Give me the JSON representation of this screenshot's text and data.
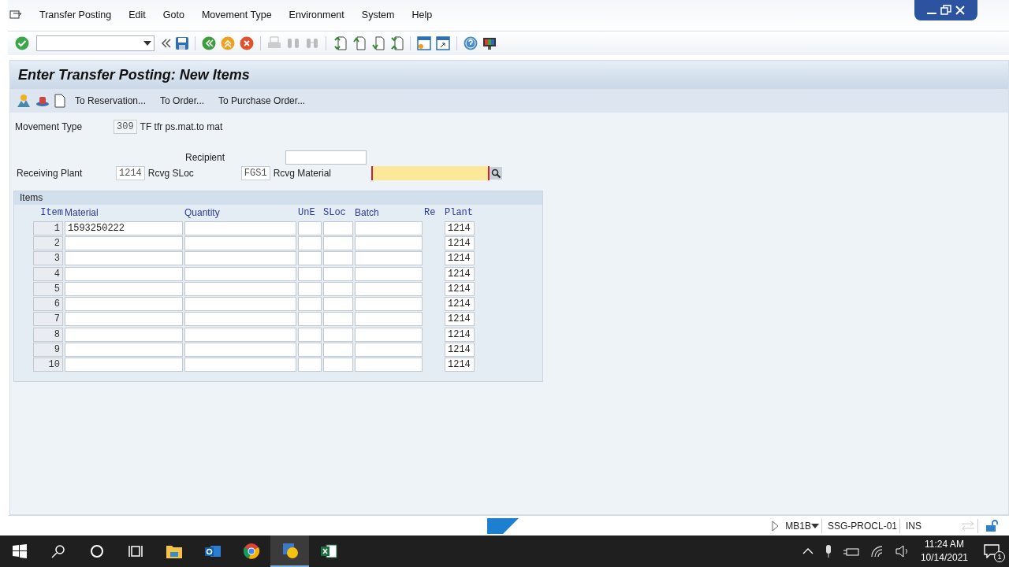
{
  "menu": [
    "Transfer Posting",
    "Edit",
    "Goto",
    "Movement Type",
    "Environment",
    "System",
    "Help"
  ],
  "title": "Enter Transfer Posting: New Items",
  "app_toolbar": [
    "To Reservation...",
    "To Order...",
    "To Purchase Order..."
  ],
  "header": {
    "movement_type": {
      "label": "Movement Type",
      "value": "309",
      "description": "TF tfr ps.mat.to mat"
    },
    "recipient": {
      "label": "Recipient"
    },
    "receiving_plant": {
      "label": "Receiving Plant",
      "value": "1214"
    },
    "rcvg_sloc": {
      "label": "Rcvg SLoc",
      "value": "FGS1"
    },
    "rcvg_material": {
      "label": "Rcvg Material",
      "focused": true
    }
  },
  "items": {
    "title": "Items",
    "columns": [
      "Item",
      "Material",
      "Quantity",
      "UnE",
      "SLoc",
      "Batch",
      "Re",
      "Plant"
    ],
    "rows": [
      {
        "item": "1",
        "material": "1593250222",
        "plant": "1214"
      },
      {
        "item": "2",
        "plant": "1214"
      },
      {
        "item": "3",
        "plant": "1214"
      },
      {
        "item": "4",
        "plant": "1214"
      },
      {
        "item": "5",
        "plant": "1214"
      },
      {
        "item": "6",
        "plant": "1214"
      },
      {
        "item": "7",
        "plant": "1214"
      },
      {
        "item": "8",
        "plant": "1214"
      },
      {
        "item": "9",
        "plant": "1214"
      },
      {
        "item": "10",
        "plant": "1214"
      }
    ]
  },
  "status_bar": {
    "transaction": "MB1B",
    "server": "SSG-PROCL-01",
    "mode": "INS"
  },
  "taskbar": {
    "apps": [
      {
        "kind": "folder",
        "selected": false
      },
      {
        "kind": "mail",
        "selected": false
      },
      {
        "kind": "browser",
        "selected": false
      },
      {
        "kind": "sap",
        "selected": true
      },
      {
        "kind": "sheet",
        "selected": false
      }
    ],
    "time": "11:24 AM",
    "date": "10/14/2021",
    "notifications": "1"
  }
}
